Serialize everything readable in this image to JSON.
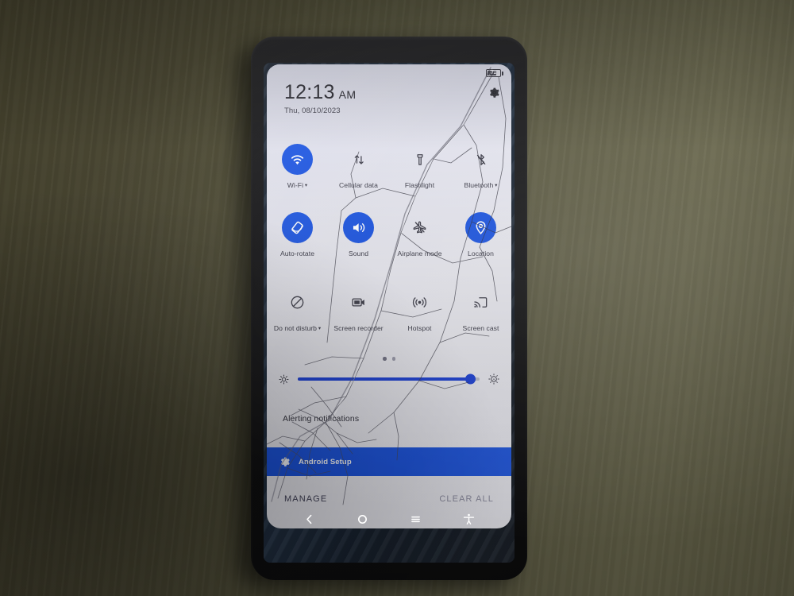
{
  "scene": {
    "description": "smartphone-on-desk",
    "desk_color": "#4a4733",
    "phone_body_color": "#17171a"
  },
  "status_bar": {
    "battery_level": "71"
  },
  "shade": {
    "clock": {
      "time": "12:13",
      "ampm": "AM",
      "date": "Thu, 08/10/2023"
    },
    "settings_icon": "gear-icon",
    "accent_color": "#1a53e0",
    "background_color": "#e9e9f0",
    "tiles": [
      {
        "label": "Wi-Fi",
        "icon": "wifi-icon",
        "state": "on",
        "caret": true
      },
      {
        "label": "Cellular data",
        "icon": "cellular-data-icon",
        "state": "off",
        "caret": false
      },
      {
        "label": "Flashlight",
        "icon": "flashlight-icon",
        "state": "off",
        "caret": false
      },
      {
        "label": "Bluetooth",
        "icon": "bluetooth-off-icon",
        "state": "off",
        "caret": true
      },
      {
        "label": "Auto-rotate",
        "icon": "auto-rotate-icon",
        "state": "on",
        "caret": false
      },
      {
        "label": "Sound",
        "icon": "sound-icon",
        "state": "on",
        "caret": false
      },
      {
        "label": "Airplane mode",
        "icon": "airplane-off-icon",
        "state": "off",
        "caret": false
      },
      {
        "label": "Location",
        "icon": "location-pin-icon",
        "state": "on",
        "caret": false
      },
      {
        "label": "Do not disturb",
        "icon": "do-not-disturb-icon",
        "state": "off",
        "caret": true
      },
      {
        "label": "Screen recorder",
        "icon": "screen-recorder-icon",
        "state": "off",
        "caret": false
      },
      {
        "label": "Hotspot",
        "icon": "hotspot-icon",
        "state": "off",
        "caret": false
      },
      {
        "label": "Screen cast",
        "icon": "screen-cast-icon",
        "state": "off",
        "caret": false
      }
    ],
    "pager": {
      "pages": 2,
      "active_page": 1
    },
    "brightness": {
      "value_percent": 95,
      "low_icon": "brightness-low-icon",
      "auto_icon": "brightness-auto-icon"
    },
    "notifications": {
      "section_title": "Alerting notifications",
      "items": [
        {
          "app": "Android Setup",
          "icon": "android-setup-gear-icon"
        }
      ],
      "manage_label": "MANAGE",
      "clear_all_label": "CLEAR ALL"
    }
  },
  "nav_bar": {
    "buttons": [
      {
        "name": "back",
        "icon": "chevron-left-icon"
      },
      {
        "name": "home",
        "icon": "circle-icon"
      },
      {
        "name": "recents",
        "icon": "menu-lines-icon"
      },
      {
        "name": "accessibility",
        "icon": "accessibility-icon"
      }
    ]
  }
}
